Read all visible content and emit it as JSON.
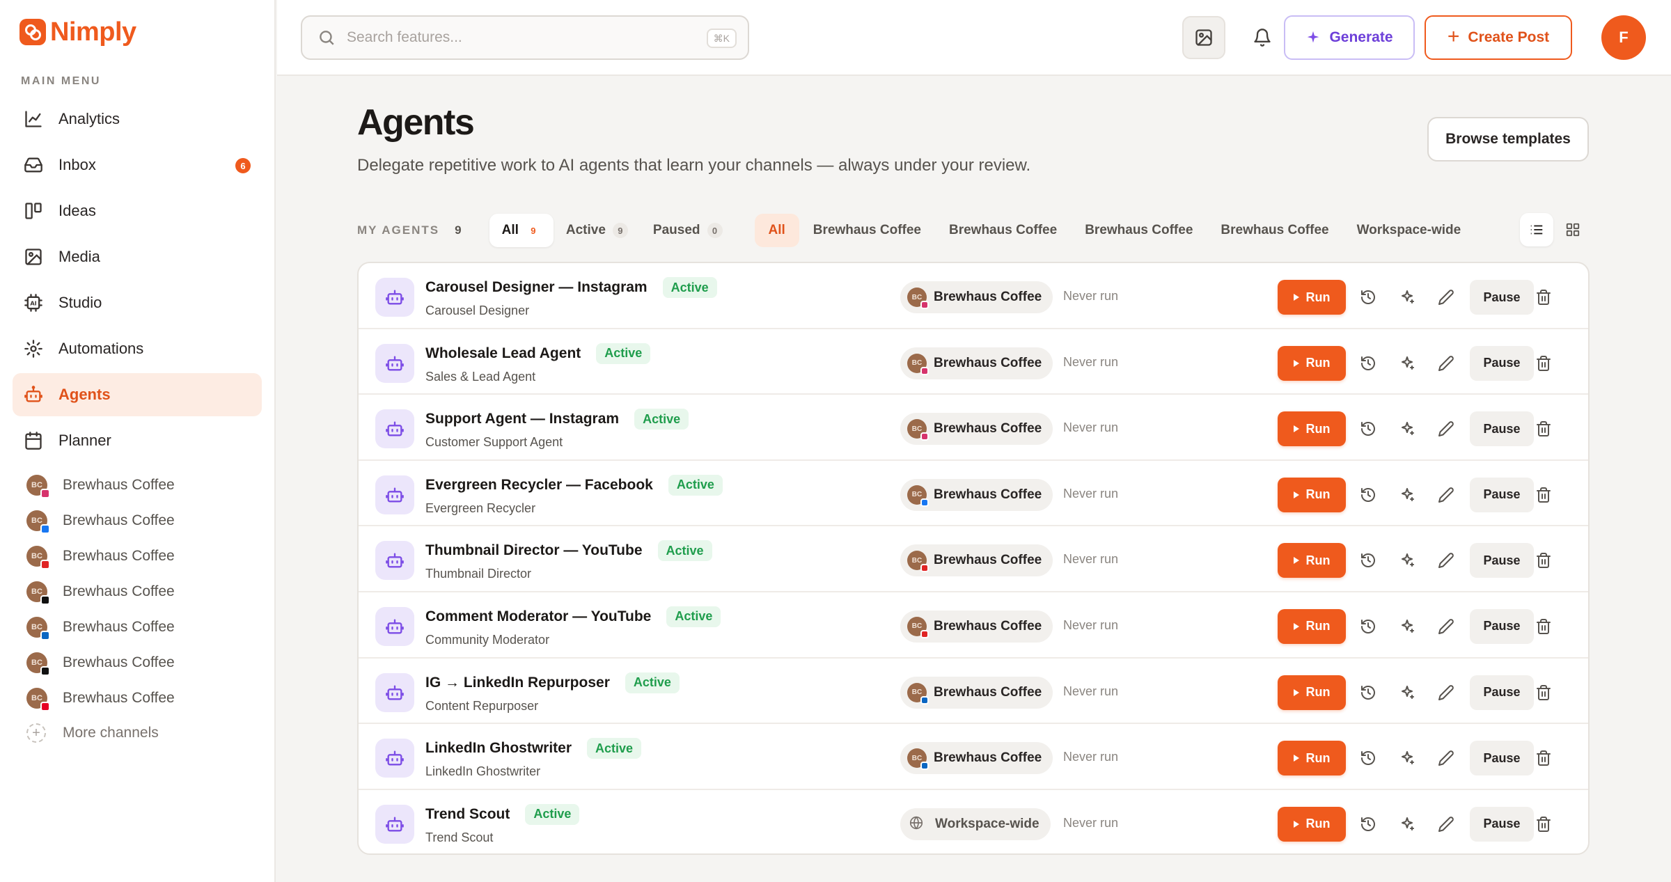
{
  "app": {
    "name": "Nimply"
  },
  "sidebar": {
    "menu_title": "MAIN MENU",
    "items": [
      {
        "label": "Analytics",
        "icon": "chart-line-icon",
        "active": false
      },
      {
        "label": "Inbox",
        "icon": "inbox-icon",
        "active": false,
        "badge": "6"
      },
      {
        "label": "Ideas",
        "icon": "kanban-icon",
        "active": false
      },
      {
        "label": "Media",
        "icon": "image-icon",
        "active": false
      },
      {
        "label": "Studio",
        "icon": "ai-chip-icon",
        "active": false
      },
      {
        "label": "Automations",
        "icon": "sun-gear-icon",
        "active": false
      },
      {
        "label": "Agents",
        "icon": "robot-icon",
        "active": true
      },
      {
        "label": "Planner",
        "icon": "calendar-icon",
        "active": false
      }
    ],
    "channels": [
      {
        "label": "Brewhaus Coffee",
        "avatar": "BC",
        "network": "instagram",
        "color": "#d6336c"
      },
      {
        "label": "Brewhaus Coffee",
        "avatar": "BC",
        "network": "facebook",
        "color": "#1877f2"
      },
      {
        "label": "Brewhaus Coffee",
        "avatar": "BC",
        "network": "youtube",
        "color": "#e02424"
      },
      {
        "label": "Brewhaus Coffee",
        "avatar": "BC",
        "network": "tiktok",
        "color": "#111111"
      },
      {
        "label": "Brewhaus Coffee",
        "avatar": "BC",
        "network": "linkedin",
        "color": "#0a66c2"
      },
      {
        "label": "Brewhaus Coffee",
        "avatar": "BC",
        "network": "x",
        "color": "#111111"
      },
      {
        "label": "Brewhaus Coffee",
        "avatar": "BC",
        "network": "pinterest",
        "color": "#e60023"
      }
    ],
    "more_channels": "More channels"
  },
  "topbar": {
    "search_placeholder": "Search features...",
    "search_shortcut": "⌘K",
    "generate_label": "Generate",
    "create_label": "Create Post",
    "user_initial": "F"
  },
  "page": {
    "title": "Agents",
    "subtitle": "Delegate repetitive work to AI agents that learn your channels — always under your review.",
    "browse_label": "Browse templates"
  },
  "filters": {
    "my_agents_label": "MY AGENTS",
    "my_agents_count": "9",
    "status_tabs": [
      {
        "label": "All",
        "count": "9",
        "selected": true
      },
      {
        "label": "Active",
        "count": "9",
        "selected": false
      },
      {
        "label": "Paused",
        "count": "0",
        "selected": false
      }
    ],
    "channel_tabs": [
      {
        "label": "All",
        "selected": true
      },
      {
        "label": "Brewhaus Coffee",
        "selected": false
      },
      {
        "label": "Brewhaus Coffee",
        "selected": false
      },
      {
        "label": "Brewhaus Coffee",
        "selected": false
      },
      {
        "label": "Brewhaus Coffee",
        "selected": false
      },
      {
        "label": "Workspace-wide",
        "selected": false
      }
    ],
    "view_modes": [
      "list-icon",
      "grid-icon"
    ]
  },
  "agents": [
    {
      "name": "Carousel Designer — Instagram",
      "status": "Active",
      "type": "Carousel Designer",
      "channel": "Brewhaus Coffee",
      "avatar": "BC",
      "network_color": "#d6336c",
      "last_run": "Never run",
      "run_label": "Run",
      "pause_label": "Pause"
    },
    {
      "name": "Wholesale Lead Agent",
      "status": "Active",
      "type": "Sales & Lead Agent",
      "channel": "Brewhaus Coffee",
      "avatar": "BC",
      "network_color": "#d6336c",
      "last_run": "Never run",
      "run_label": "Run",
      "pause_label": "Pause"
    },
    {
      "name": "Support Agent — Instagram",
      "status": "Active",
      "type": "Customer Support Agent",
      "channel": "Brewhaus Coffee",
      "avatar": "BC",
      "network_color": "#d6336c",
      "last_run": "Never run",
      "run_label": "Run",
      "pause_label": "Pause"
    },
    {
      "name": "Evergreen Recycler — Facebook",
      "status": "Active",
      "type": "Evergreen Recycler",
      "channel": "Brewhaus Coffee",
      "avatar": "BC",
      "network_color": "#1877f2",
      "last_run": "Never run",
      "run_label": "Run",
      "pause_label": "Pause"
    },
    {
      "name": "Thumbnail Director — YouTube",
      "status": "Active",
      "type": "Thumbnail Director",
      "channel": "Brewhaus Coffee",
      "avatar": "BC",
      "network_color": "#e02424",
      "last_run": "Never run",
      "run_label": "Run",
      "pause_label": "Pause"
    },
    {
      "name": "Comment Moderator — YouTube",
      "status": "Active",
      "type": "Community Moderator",
      "channel": "Brewhaus Coffee",
      "avatar": "BC",
      "network_color": "#e02424",
      "last_run": "Never run",
      "run_label": "Run",
      "pause_label": "Pause"
    },
    {
      "name": "IG → LinkedIn Repurposer",
      "status": "Active",
      "type": "Content Repurposer",
      "channel": "Brewhaus Coffee",
      "avatar": "BC",
      "network_color": "#0a66c2",
      "last_run": "Never run",
      "run_label": "Run",
      "pause_label": "Pause"
    },
    {
      "name": "LinkedIn Ghostwriter",
      "status": "Active",
      "type": "LinkedIn Ghostwriter",
      "channel": "Brewhaus Coffee",
      "avatar": "BC",
      "network_color": "#0a66c2",
      "last_run": "Never run",
      "run_label": "Run",
      "pause_label": "Pause"
    },
    {
      "name": "Trend Scout",
      "status": "Active",
      "type": "Trend Scout",
      "channel": "Workspace-wide",
      "workspace": true,
      "last_run": "Never run",
      "run_label": "Run",
      "pause_label": "Pause"
    }
  ]
}
